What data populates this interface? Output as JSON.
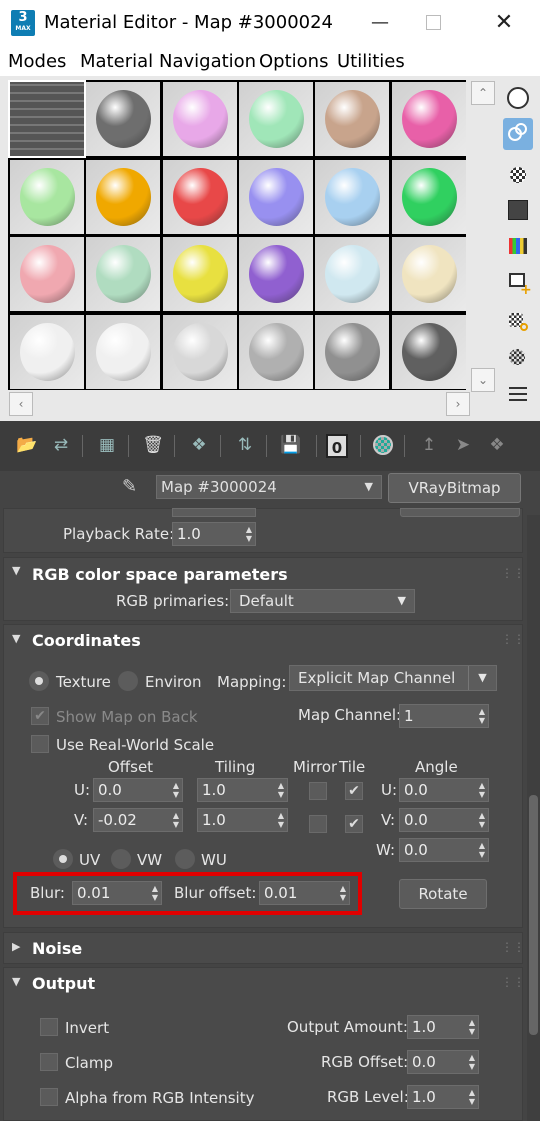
{
  "window": {
    "icon_text": "3",
    "icon_subtext": "MAX",
    "title": "Material Editor - Map #3000024"
  },
  "menu": [
    "Modes",
    "Material",
    "Navigation",
    "Options",
    "Utilities"
  ],
  "slots": {
    "colors": [
      [
        "#6a6a6a",
        "#6e6e6e",
        "#e8a8e8",
        "#a0e6b8",
        "#c8a48c",
        "#e860a8"
      ],
      [
        "#a8e6a0",
        "#f0a800",
        "#e84848",
        "#9890f0",
        "#a8d0f0",
        "#30d060"
      ],
      [
        "#f0a8b0",
        "#b0dcc0",
        "#e8e040",
        "#9060d0",
        "#d0e8f0",
        "#f0e4c0"
      ],
      [
        "#f0f0f0",
        "#f0f0f0",
        "#d8d8d8",
        "#b0b0b0",
        "#909090",
        "#606060"
      ]
    ]
  },
  "toolbar": {
    "map_name": "Map #3000024",
    "map_type": "VRayBitmap",
    "zero_label": "0"
  },
  "playback": {
    "label": "Playback Rate:",
    "value": "1.0"
  },
  "rgb_colorspace": {
    "header": "RGB color space parameters",
    "primaries_label": "RGB primaries:",
    "primaries_value": "Default"
  },
  "coordinates": {
    "header": "Coordinates",
    "texture_label": "Texture",
    "environ_label": "Environ",
    "mapping_label": "Mapping:",
    "mapping_value": "Explicit Map Channel",
    "show_map_label": "Show Map on Back",
    "map_channel_label": "Map Channel:",
    "map_channel_value": "1",
    "real_world_label": "Use Real-World Scale",
    "col_offset": "Offset",
    "col_tiling": "Tiling",
    "col_mirror": "Mirror",
    "col_tile": "Tile",
    "col_angle": "Angle",
    "u_label": "U:",
    "v_label": "V:",
    "w_label": "W:",
    "u_offset": "0.0",
    "v_offset": "-0.02",
    "u_tiling": "1.0",
    "v_tiling": "1.0",
    "u_angle": "0.0",
    "v_angle": "0.0",
    "w_angle": "0.0",
    "uv_label": "UV",
    "vw_label": "VW",
    "wu_label": "WU",
    "blur_label": "Blur:",
    "blur_value": "0.01",
    "blur_offset_label": "Blur offset:",
    "blur_offset_value": "0.01",
    "rotate_label": "Rotate"
  },
  "noise": {
    "header": "Noise"
  },
  "output": {
    "header": "Output",
    "invert_label": "Invert",
    "clamp_label": "Clamp",
    "alpha_label": "Alpha from RGB Intensity",
    "amount_label": "Output Amount:",
    "amount_value": "1.0",
    "rgb_offset_label": "RGB Offset:",
    "rgb_offset_value": "0.0",
    "rgb_level_label": "RGB Level:",
    "rgb_level_value": "1.0"
  }
}
